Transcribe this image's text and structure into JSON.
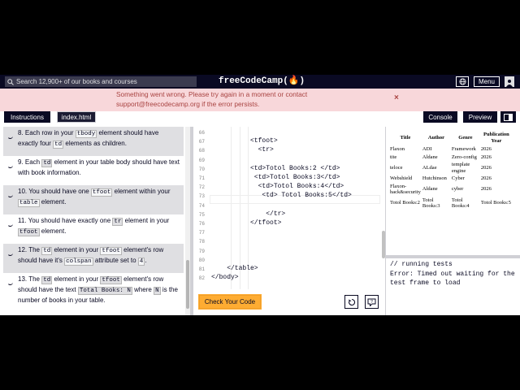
{
  "navbar": {
    "search_placeholder": "Search 12,900+ of our books and courses",
    "brand": "freeCodeCamp(🔥)",
    "menu_label": "Menu"
  },
  "flash": {
    "message": "Something went wrong. Please try again in a moment or contact support@freecodecamp.org if the error persists.",
    "close": "×"
  },
  "tabs": {
    "instructions": "Instructions",
    "file": "index.html",
    "console": "Console",
    "preview": "Preview"
  },
  "tests": [
    {
      "num": "8.",
      "parts": [
        " Each row in your ",
        {
          "code": "tbody"
        },
        " element should have exactly four ",
        {
          "code": "td"
        },
        " elements as children."
      ]
    },
    {
      "num": "9.",
      "parts": [
        " Each ",
        {
          "code": "td"
        },
        " element in your table body should have text with book information."
      ]
    },
    {
      "num": "10.",
      "parts": [
        " You should have one ",
        {
          "code": "tfoot"
        },
        " element within your ",
        {
          "code": "table"
        },
        " element."
      ]
    },
    {
      "num": "11.",
      "parts": [
        " You should have exactly one ",
        {
          "code": "tr"
        },
        " element in your ",
        {
          "code": "tfoot"
        },
        " element."
      ]
    },
    {
      "num": "12.",
      "parts": [
        " The ",
        {
          "code": "td"
        },
        " element in your ",
        {
          "code": "tfoot"
        },
        " element's row should have it's ",
        {
          "code": "colspan"
        },
        " attribute set to ",
        {
          "code": "4"
        },
        "."
      ]
    },
    {
      "num": "13.",
      "parts": [
        " The ",
        {
          "code": "td"
        },
        " element in your ",
        {
          "code": "tfoot"
        },
        " element's row should have the text ",
        {
          "code": "Total Books: N"
        },
        " where ",
        {
          "code": "N"
        },
        " is the number of books in your table."
      ]
    }
  ],
  "editor": {
    "lines": [
      {
        "n": "66",
        "text": ""
      },
      {
        "n": "67",
        "text": "          <tfoot>"
      },
      {
        "n": "68",
        "text": "            <tr>"
      },
      {
        "n": "69",
        "text": ""
      },
      {
        "n": "70",
        "text": "          <td>Totol Books:2 </td>"
      },
      {
        "n": "71",
        "text": "           <td>Totol Books:3</td>"
      },
      {
        "n": "72",
        "text": "            <td>Totol Books:4</td>"
      },
      {
        "n": "73",
        "text": "             <td> Totol Books:5</td>"
      },
      {
        "n": "74",
        "text": ""
      },
      {
        "n": "75",
        "text": "              </tr>"
      },
      {
        "n": "76",
        "text": "          </tfoot>"
      },
      {
        "n": "77",
        "text": ""
      },
      {
        "n": "78",
        "text": ""
      },
      {
        "n": "79",
        "text": ""
      },
      {
        "n": "80",
        "text": ""
      },
      {
        "n": "81",
        "text": "    </table>"
      },
      {
        "n": "82",
        "text": "</body>"
      }
    ],
    "check_label": "Check Your Code"
  },
  "preview": {
    "headers": [
      "Title",
      "Author",
      "Genre",
      "Publication Year"
    ],
    "rows": [
      [
        "Flaxon",
        "ADI",
        "Framework",
        "2026"
      ],
      [
        "tite",
        "Aldane",
        "Zero-config",
        "2026"
      ],
      [
        "teloce",
        "ALdae",
        "template engine",
        "2026"
      ],
      [
        "Webshield",
        "Hutchinson",
        "Cyber",
        "2026"
      ],
      [
        "Flaxon-hack&security",
        "Aldane",
        "cyber",
        "2026"
      ]
    ],
    "footer": [
      "Totol Books:2",
      "Totol Books:3",
      "Totol Books:4",
      "Totol Books:5"
    ]
  },
  "console": {
    "text": "// running tests\nError: Timed out waiting for the test frame to load"
  },
  "colors": {
    "nav": "#0a0a23",
    "accent": "#feac32",
    "flash_bg": "#f8d7da",
    "flash_text": "#a94442"
  }
}
